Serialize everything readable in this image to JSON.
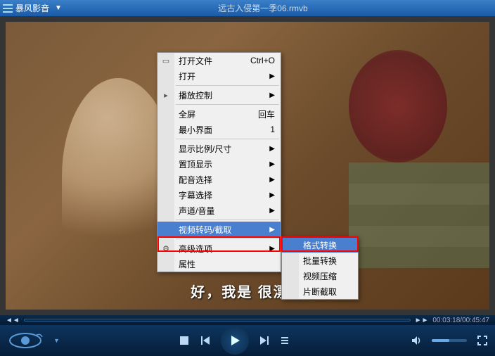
{
  "titlebar": {
    "app_name": "暴风影音",
    "file_title": "远古入侵第一季06.rmvb"
  },
  "subtitle": "好，我是                        很漂亮",
  "menu": {
    "open_file": "打开文件",
    "open_file_shortcut": "Ctrl+O",
    "open": "打开",
    "play_control": "播放控制",
    "fullscreen": "全屏",
    "fullscreen_shortcut": "回车",
    "mini_ui": "最小界面",
    "mini_ui_shortcut": "1",
    "display_ratio": "显示比例/尺寸",
    "ontop": "置顶显示",
    "audio_select": "配音选择",
    "subtitle_select": "字幕选择",
    "channel_volume": "声道/音量",
    "transcode": "视频转码/截取",
    "advanced": "高级选项",
    "properties": "属性"
  },
  "submenu": {
    "format_convert": "格式转换",
    "batch_convert": "批量转换",
    "video_compress": "视频压缩",
    "clip_capture": "片断截取"
  },
  "seekbar": {
    "time_display": "00:03:18/00:45:47"
  }
}
